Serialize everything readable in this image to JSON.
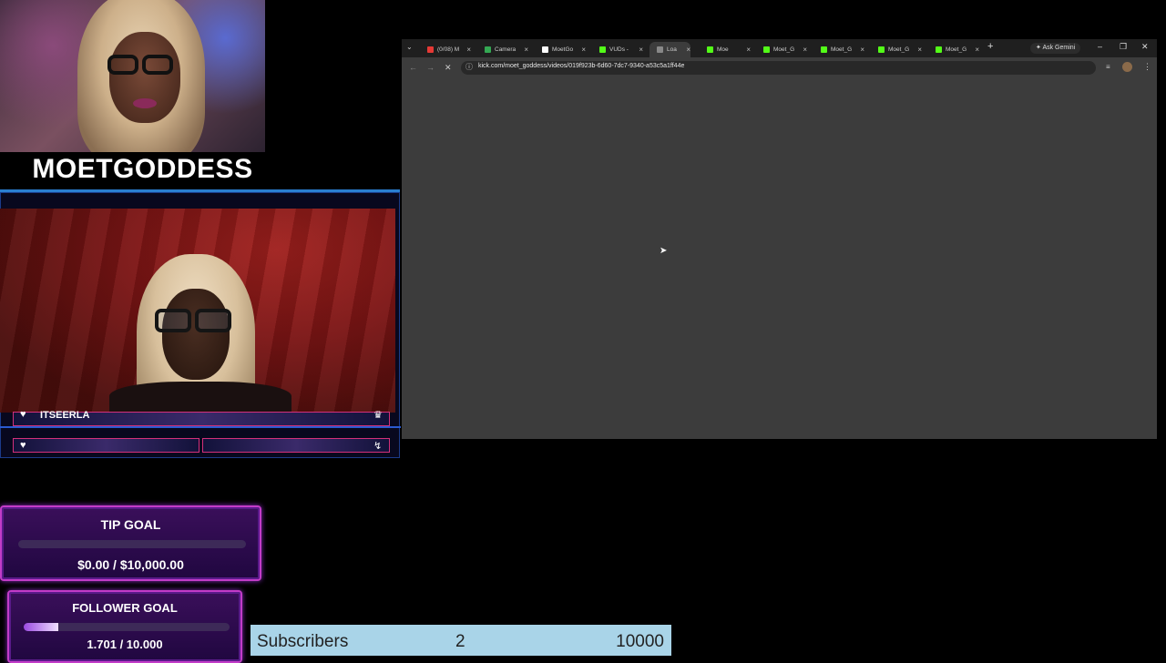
{
  "overlay": {
    "streamer_name": "MOETGODDESS",
    "chat": {
      "username": "ITSEERLA"
    },
    "tip_goal": {
      "title": "TIP GOAL",
      "amount": "$0.00 / $10,000.00",
      "progress": 0.0
    },
    "follower_goal": {
      "title": "FOLLOWER GOAL",
      "amount": "1.701 / 10.000",
      "progress": 0.17
    },
    "subscribers": {
      "label": "Subscribers",
      "current": "2",
      "target": "10000"
    }
  },
  "browser": {
    "tabs": [
      {
        "label": "(0/08) M",
        "color": "#e53935"
      },
      {
        "label": "Camera",
        "color": "#34a853"
      },
      {
        "label": "MoetGo",
        "color": "#ffffff"
      },
      {
        "label": "VUDs -",
        "color": "#53fc18"
      },
      {
        "label": "Loa",
        "color": "#888888",
        "active": true
      },
      {
        "label": "Moe",
        "color": "#53fc18"
      },
      {
        "label": "Moet_G",
        "color": "#53fc18"
      },
      {
        "label": "Moet_G",
        "color": "#53fc18"
      },
      {
        "label": "Moet_G",
        "color": "#53fc18"
      },
      {
        "label": "Moet_G",
        "color": "#53fc18"
      }
    ],
    "ask_gemini": "Ask Gemini",
    "url": "kick.com/moet_goddess/videos/019f923b-6d60-7dc7-9340-a53c5a1ff44e"
  }
}
